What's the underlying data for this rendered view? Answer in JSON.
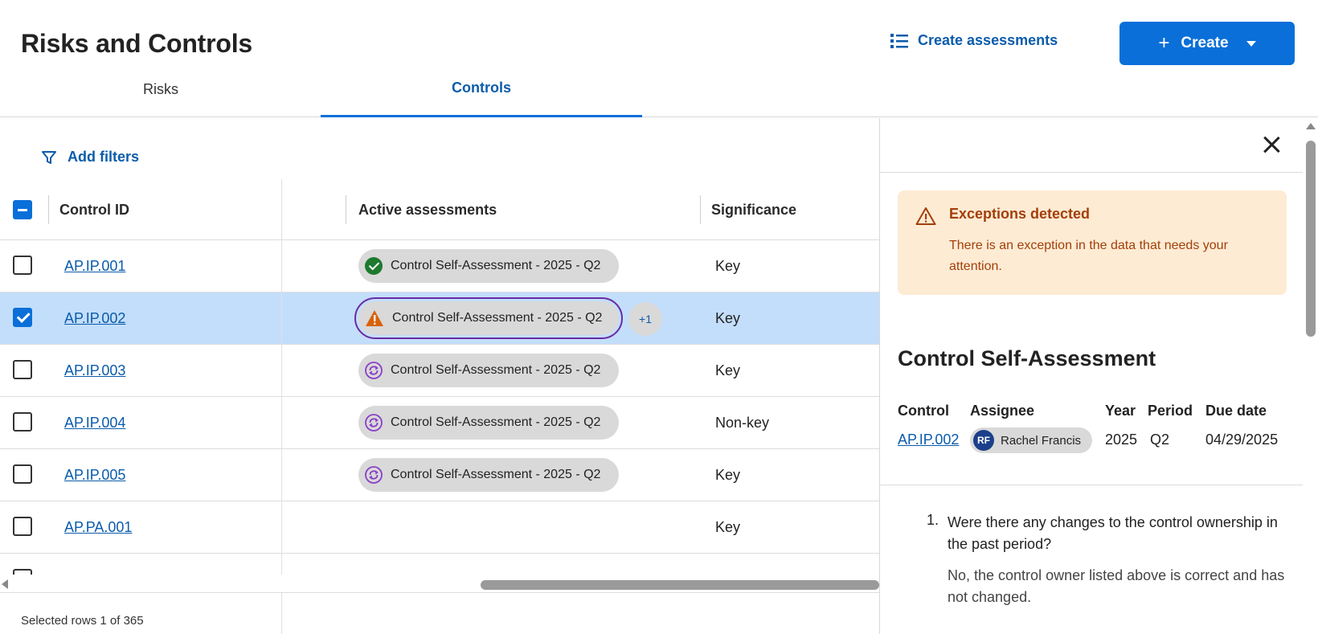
{
  "header": {
    "title": "Risks and Controls",
    "create_assessments_label": "Create assessments",
    "create_label": "Create"
  },
  "tabs": [
    {
      "label": "Risks",
      "active": false
    },
    {
      "label": "Controls",
      "active": true
    }
  ],
  "filters": {
    "label": "Add filters"
  },
  "table": {
    "columns": [
      "Control ID",
      "Active assessments",
      "Significance"
    ],
    "rows": [
      {
        "id": "AP.IP.001",
        "assessment": "Control Self-Assessment - 2025 - Q2",
        "status_icon": "check-circle-icon",
        "significance": "Key",
        "selected": false
      },
      {
        "id": "AP.IP.002",
        "assessment": "Control Self-Assessment - 2025 - Q2",
        "status_icon": "warning-icon",
        "significance": "Key",
        "selected": true,
        "extra": "+1"
      },
      {
        "id": "AP.IP.003",
        "assessment": "Control Self-Assessment - 2025 - Q2",
        "status_icon": "in-progress-icon",
        "significance": "Key",
        "selected": false
      },
      {
        "id": "AP.IP.004",
        "assessment": "Control Self-Assessment - 2025 - Q2",
        "status_icon": "in-progress-icon",
        "significance": "Non-key",
        "selected": false
      },
      {
        "id": "AP.IP.005",
        "assessment": "Control Self-Assessment - 2025 - Q2",
        "status_icon": "in-progress-icon",
        "significance": "Key",
        "selected": false
      },
      {
        "id": "AP.PA.001",
        "assessment": "",
        "status_icon": "",
        "significance": "Key",
        "selected": false
      }
    ]
  },
  "footer": {
    "selection_text": "Selected rows 1 of 365"
  },
  "panel": {
    "alert": {
      "title": "Exceptions detected",
      "body": "There is an exception in the data that needs your attention."
    },
    "heading": "Control Self-Assessment",
    "meta": {
      "headers": [
        "Control",
        "Assignee",
        "Year",
        "Period",
        "Due date"
      ],
      "control": "AP.IP.002",
      "assignee_initials": "RF",
      "assignee_name": "Rachel Francis",
      "year": "2025",
      "period": "Q2",
      "due_date": "04/29/2025"
    },
    "question": {
      "number": "1.",
      "text": "Were there any changes to the control ownership in the past period?",
      "answer": "No, the control owner listed above is correct and has not changed."
    }
  },
  "colors": {
    "accent": "#0a6fd9",
    "link": "#0b5cab",
    "selected_row": "#c3defb",
    "alert_bg": "#fdebd4",
    "alert_text": "#a33f0a",
    "success": "#1d7a2e",
    "warning": "#d9620b",
    "in_progress": "#8a3fc8"
  }
}
